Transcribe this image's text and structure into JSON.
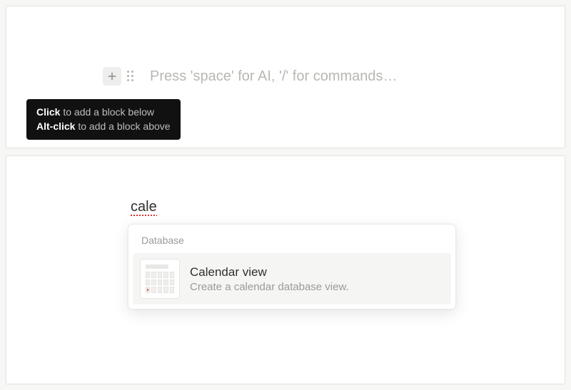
{
  "top": {
    "placeholder": "Press 'space' for AI, '/' for commands…",
    "tooltip": {
      "line1_bold": "Click",
      "line1_rest": " to add a block below",
      "line2_bold": "Alt-click",
      "line2_rest": " to add a block above"
    }
  },
  "bottom": {
    "query": "cale",
    "section_label": "Database",
    "item": {
      "title": "Calendar view",
      "description": "Create a calendar database view."
    }
  }
}
